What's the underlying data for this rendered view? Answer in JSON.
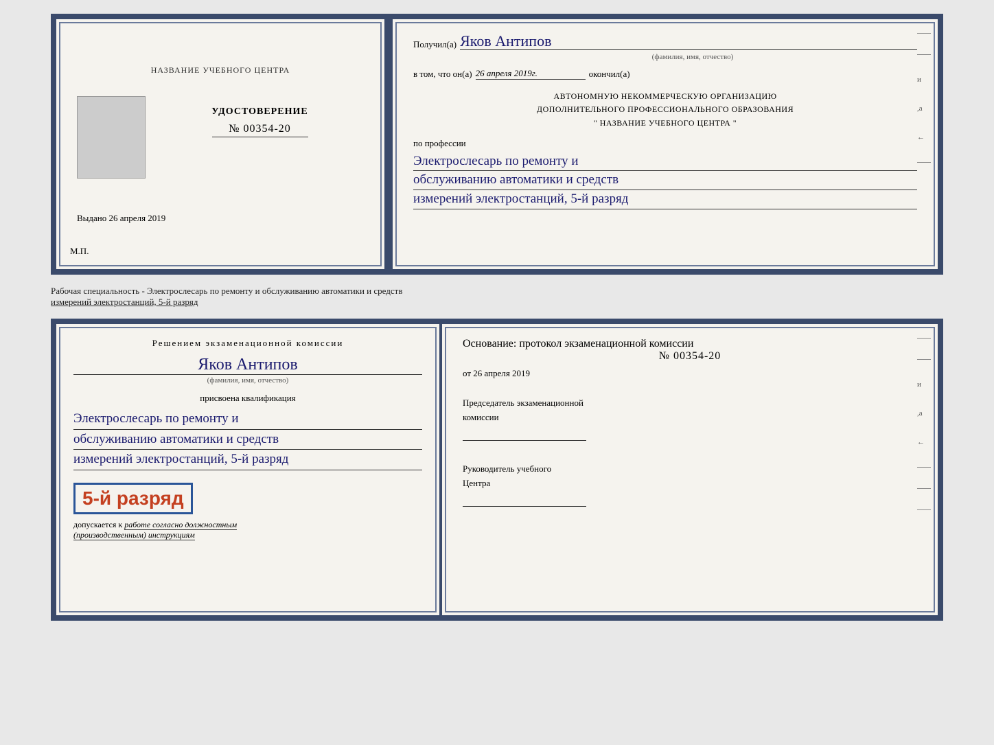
{
  "top": {
    "left": {
      "center_title": "НАЗВАНИЕ УЧЕБНОГО ЦЕНТРА",
      "udostoverenie": "УДОСТОВЕРЕНИЕ",
      "number": "№ 00354-20",
      "vydano": "Выдано",
      "vydano_date": "26 апреля 2019",
      "mp": "М.П."
    },
    "right": {
      "poluchil_label": "Получил(а)",
      "name_handwritten": "Яков Антипов",
      "fio_label": "(фамилия, имя, отчество)",
      "vtom_label": "в том, что он(а)",
      "date_handwritten": "26 апреля 2019г.",
      "okonchil": "окончил(а)",
      "org_line1": "АВТОНОМНУЮ НЕКОММЕРЧЕСКУЮ ОРГАНИЗАЦИЮ",
      "org_line2": "ДОПОЛНИТЕЛЬНОГО ПРОФЕССИОНАЛЬНОГО ОБРАЗОВАНИЯ",
      "org_line3": "\"   НАЗВАНИЕ УЧЕБНОГО ЦЕНТРА   \"",
      "po_professii": "по профессии",
      "profession_line1": "Электрослесарь по ремонту и",
      "profession_line2": "обслуживанию автоматики и средств",
      "profession_line3": "измерений электростанций, 5-й разряд"
    }
  },
  "middle": {
    "text": "Рабочая специальность - Электрослесарь по ремонту и обслуживанию автоматики и средств",
    "text2": "измерений электростанций, 5-й разряд"
  },
  "bottom": {
    "left": {
      "resheniem": "Решением экзаменационной  комиссии",
      "name_handwritten": "Яков Антипов",
      "fio_label": "(фамилия, имя, отчество)",
      "prisvoena": "присвоена квалификация",
      "qual_line1": "Электрослесарь по ремонту и",
      "qual_line2": "обслуживанию автоматики и средств",
      "qual_line3": "измерений электростанций, 5-й разряд",
      "razryad_badge": "5-й разряд",
      "dopuskaetsya": "допускается к",
      "dopuskaetsya_underline": "работе согласно должностным",
      "instruktsii": "(производственным) инструкциям"
    },
    "right": {
      "osnovanie": "Основание: протокол экзаменационной  комиссии",
      "protocol_number": "№  00354-20",
      "ot_label": "от",
      "ot_date": "26 апреля 2019",
      "predsedatel_line1": "Председатель экзаменационной",
      "predsedatel_line2": "комиссии",
      "rukovoditel_line1": "Руководитель учебного",
      "rukovoditel_line2": "Центра"
    }
  }
}
